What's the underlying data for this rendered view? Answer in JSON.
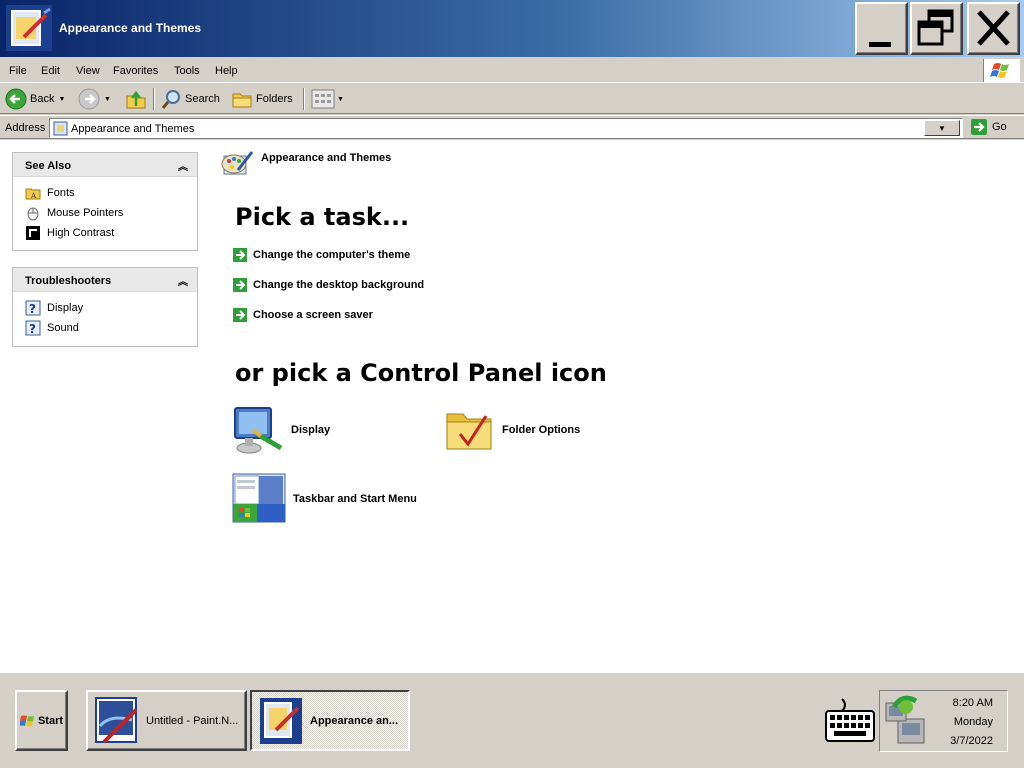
{
  "window": {
    "title": "Appearance and Themes",
    "minimize_icon": "minimize-icon",
    "restore_icon": "restore-icon",
    "close_icon": "close-icon"
  },
  "menu": {
    "items": [
      "File",
      "Edit",
      "View",
      "Favorites",
      "Tools",
      "Help"
    ]
  },
  "toolbar": {
    "back_label": "Back",
    "search_label": "Search",
    "folders_label": "Folders"
  },
  "address": {
    "label": "Address",
    "value": "Appearance and Themes",
    "go_label": "Go"
  },
  "see_also": {
    "title": "See Also",
    "links": [
      {
        "label": "Fonts",
        "icon": "fonts-folder-icon"
      },
      {
        "label": "Mouse Pointers",
        "icon": "mouse-icon"
      },
      {
        "label": "High Contrast",
        "icon": "high-contrast-icon"
      }
    ]
  },
  "troubleshooters": {
    "title": "Troubleshooters",
    "links": [
      {
        "label": "Display",
        "icon": "help-icon"
      },
      {
        "label": "Sound",
        "icon": "help-icon"
      }
    ]
  },
  "main": {
    "category_title": "Appearance and Themes",
    "pick_task_heading": "Pick a task...",
    "tasks": [
      "Change the computer's theme",
      "Change the desktop background",
      "Choose a screen saver"
    ],
    "pick_icon_heading": "or pick a Control Panel icon",
    "icons": [
      {
        "label": "Display",
        "icon": "display-icon"
      },
      {
        "label": "Folder Options",
        "icon": "folder-options-icon"
      },
      {
        "label": "Taskbar and Start Menu",
        "icon": "taskbar-icon"
      }
    ]
  },
  "taskbar": {
    "start_label": "Start",
    "tasks": [
      {
        "label": "Untitled - Paint.N...",
        "active": false
      },
      {
        "label": "Appearance an...",
        "active": true
      }
    ],
    "clock": {
      "time": "8:20 AM",
      "day": "Monday",
      "date": "3/7/2022"
    }
  },
  "colors": {
    "title_gradient_start": "#0a246a",
    "title_gradient_end": "#a6caf0",
    "face": "#d4d0c8",
    "task_arrow": "#2e9e38"
  }
}
